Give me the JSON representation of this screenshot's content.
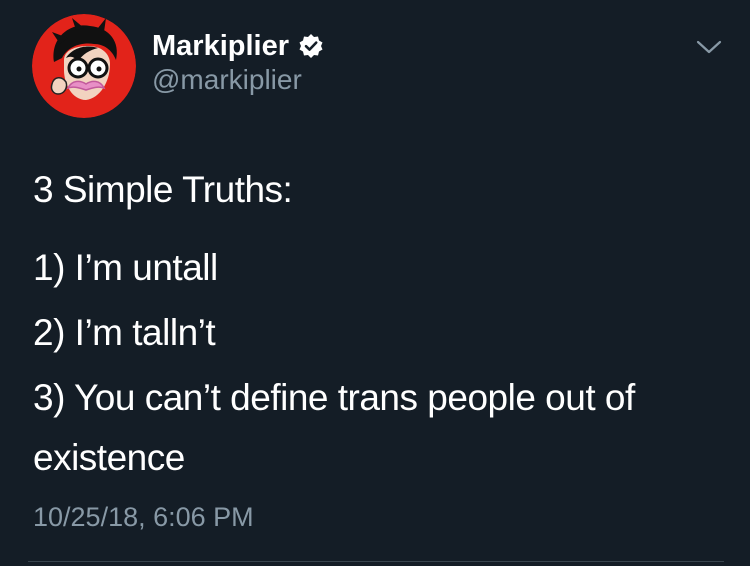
{
  "tweet": {
    "author": {
      "display_name": "Markiplier",
      "handle": "@markiplier",
      "verified": true,
      "avatar_icon": "markiplier-cartoon-avatar"
    },
    "menu_icon": "chevron-down-icon",
    "text": {
      "heading": "3 Simple Truths:",
      "lines": [
        "1) I’m untall",
        "2) I’m talln’t",
        "3) You can’t define trans people out of",
        "existence"
      ]
    },
    "timestamp": "10/25/18, 6:06 PM"
  },
  "colors": {
    "background": "#141d26",
    "text_primary": "#ffffff",
    "text_secondary": "#8899a6",
    "divider": "#38444d",
    "avatar_red": "#e2231a"
  }
}
